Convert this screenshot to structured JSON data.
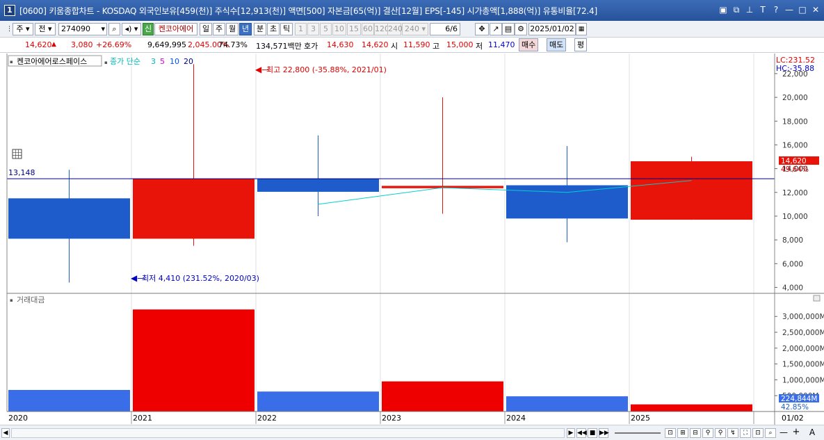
{
  "window": {
    "number": "1",
    "title": "[0600] 키움종합차트 - KOSDAQ 외국인보유[459(천)] 주식수[12,913(천)] 액면[500] 자본금[65(억)] 결산[12월] EPS[-145] 시가총액[1,888(억)] 유통비율[72.4]"
  },
  "toolbar": {
    "period_type": "주",
    "prev_label": "전",
    "code": "274090",
    "new_badge": "신",
    "stock_name": "켄코아에어",
    "period_buttons": [
      "일",
      "주",
      "월",
      "년",
      "분",
      "초",
      "틱"
    ],
    "selected_period": "년",
    "interval_buttons": [
      "1",
      "3",
      "5",
      "10",
      "15",
      "60",
      "120",
      "240"
    ],
    "interval_select": "240",
    "count": "6",
    "count_total": "/6",
    "date": "2025/01/02"
  },
  "quote": {
    "price": "14,620",
    "change_arrow": "▲",
    "change": "3,080",
    "change_pct": "+26.69%",
    "volume": "9,649,995",
    "volume_ratio": "2,045.00%",
    "turnover": "74.73%",
    "amount": "134,571백만",
    "ask_label": "호가",
    "ask1": "14,630",
    "ask2": "14,620",
    "open_label": "시",
    "open": "11,590",
    "high_label": "고",
    "high": "15,000",
    "low_label": "저",
    "low": "11,470",
    "buy_label": "매수",
    "sell_label": "매도",
    "eval_label": "평"
  },
  "price_panel": {
    "stock_label": "켄코아에어로스페이스",
    "ma_title": "종가 단순",
    "ma_periods": [
      "3",
      "5",
      "10",
      "20"
    ],
    "ma_colors": [
      "#00c8c8",
      "#d000d0",
      "#0050ff",
      "#000080"
    ],
    "lc_label": "LC:231.52",
    "hc_label": "HC:-35.88",
    "high_note": "최고 22,800 (-35.88%, 2021/01)",
    "low_note": "최저 4,410 (231.52%, 2020/03)",
    "ref_line_label": "13,148",
    "ref_line_value": 13148,
    "current_price_label": "14,620",
    "current_pct_label": "49.64%",
    "y_ticks": [
      "22,000",
      "20,000",
      "18,000",
      "16,000",
      "14,000",
      "12,000",
      "10,000",
      "8,000",
      "6,000",
      "4,000"
    ]
  },
  "volume_panel": {
    "label": "거래대금",
    "y_ticks": [
      "3,000,000M",
      "2,500,000M",
      "2,000,000M",
      "1,500,000M",
      "1,000,000M",
      "500,000M"
    ],
    "current_label": "224,844M",
    "current_pct": "42.85%"
  },
  "x_axis": {
    "labels": [
      "2020",
      "2021",
      "2022",
      "2023",
      "2024",
      "2025"
    ],
    "right_label": "01/02"
  },
  "colors": {
    "up": "#e8140a",
    "down": "#1e5ccc",
    "vol_up": "#ee0000",
    "vol_down": "#3a6ee8",
    "ma": "#00d0d0",
    "ref_line": "#000080"
  },
  "chart_data": {
    "type": "candlestick",
    "x": [
      "2020",
      "2021",
      "2022",
      "2023",
      "2024",
      "2025"
    ],
    "candles": [
      {
        "open": 8100,
        "high": 13900,
        "low": 4410,
        "close": 11500,
        "dir": "down"
      },
      {
        "open": 8100,
        "high": 22800,
        "low": 7500,
        "close": 13148,
        "dir": "up"
      },
      {
        "open": 13148,
        "high": 16800,
        "low": 10000,
        "close": 12050,
        "dir": "down"
      },
      {
        "open": 12350,
        "high": 20000,
        "low": 10200,
        "close": 12550,
        "dir": "up"
      },
      {
        "open": 12600,
        "high": 15900,
        "low": 7800,
        "close": 9800,
        "dir": "down"
      },
      {
        "open": 9700,
        "high": 15000,
        "low": 9700,
        "close": 14620,
        "dir": "up"
      }
    ],
    "ma3": [
      null,
      null,
      11000,
      12400,
      12000,
      13000
    ],
    "volume_amount_M": [
      680000,
      3220000,
      630000,
      950000,
      480000,
      224844
    ],
    "y_price_range": [
      3500,
      23400
    ],
    "y_volume_range": [
      0,
      3400000
    ]
  }
}
